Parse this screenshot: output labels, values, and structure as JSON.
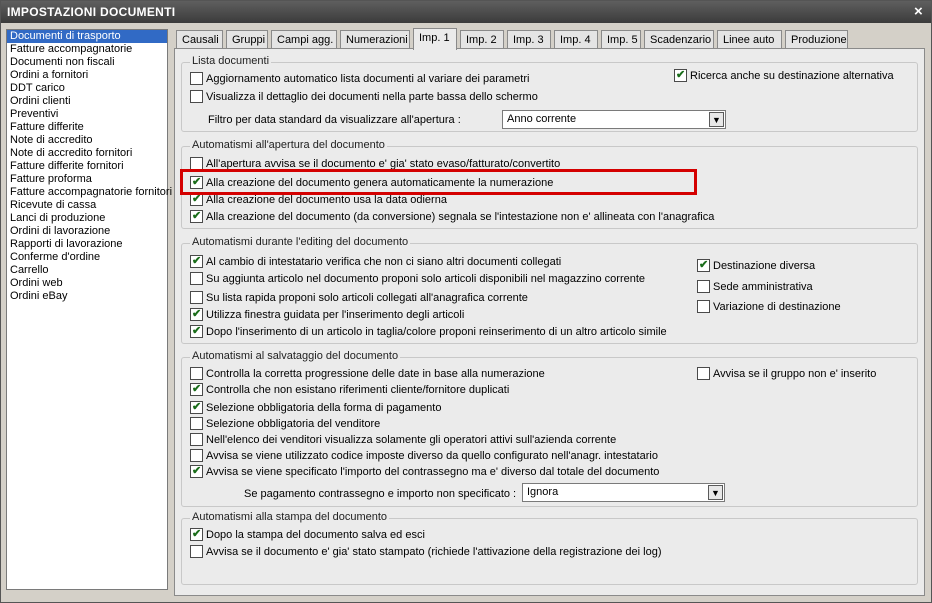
{
  "window": {
    "title": "IMPOSTAZIONI DOCUMENTI",
    "close_glyph": "×"
  },
  "sidebar": {
    "selected_index": 0,
    "items": [
      "Documenti di trasporto",
      "Fatture accompagnatorie",
      "Documenti non fiscali",
      "Ordini a fornitori",
      "DDT carico",
      "Ordini clienti",
      "Preventivi",
      "Fatture differite",
      "Note di accredito",
      "Note di accredito fornitori",
      "Fatture differite fornitori",
      "Fatture proforma",
      "Fatture accompagnatorie fornitori",
      "Ricevute di cassa",
      "Lanci di produzione",
      "Ordini di lavorazione",
      "Rapporti di lavorazione",
      "Conferme d'ordine",
      "Carrello",
      "Ordini web",
      "Ordini eBay"
    ]
  },
  "tabs": {
    "active_index": 4,
    "items": [
      "Causali",
      "Gruppi",
      "Campi agg.",
      "Numerazioni",
      "Imp. 1",
      "Imp. 2",
      "Imp. 3",
      "Imp. 4",
      "Imp. 5",
      "Scadenzario",
      "Linee auto",
      "Produzione"
    ]
  },
  "groups": {
    "lista": {
      "title": "Lista documenti",
      "options": [
        {
          "label": "Aggiornamento automatico lista documenti al variare dei parametri",
          "checked": false
        },
        {
          "label": "Visualizza il dettaglio dei documenti nella parte bassa dello schermo",
          "checked": false
        },
        {
          "label": "Ricerca anche su destinazione alternativa",
          "checked": true
        }
      ],
      "filter_label": "Filtro per data standard da visualizzare all'apertura :",
      "filter_value": "Anno corrente"
    },
    "apertura": {
      "title": "Automatismi all'apertura del documento",
      "options": [
        {
          "label": "All'apertura avvisa se il documento e' gia' stato evaso/fatturato/convertito",
          "checked": false
        },
        {
          "label": "Alla creazione del documento genera automaticamente la numerazione",
          "checked": true
        },
        {
          "label": "Alla creazione del documento usa la data odierna",
          "checked": true
        },
        {
          "label": "Alla creazione del documento (da conversione) segnala se l'intestazione non e' allineata con l'anagrafica",
          "checked": true
        }
      ]
    },
    "editing": {
      "title": "Automatismi durante l'editing del documento",
      "options": [
        {
          "label": "Al cambio di intestatario verifica che non ci siano altri documenti collegati",
          "checked": true
        },
        {
          "label": "Su aggiunta articolo nel documento proponi solo articoli disponibili nel magazzino corrente",
          "checked": false
        },
        {
          "label": "Su lista rapida proponi solo articoli collegati all'anagrafica corrente",
          "checked": false
        },
        {
          "label": "Utilizza finestra guidata per l'inserimento degli articoli",
          "checked": true
        },
        {
          "label": "Dopo l'inserimento di un articolo in taglia/colore proponi reinserimento di un altro articolo simile",
          "checked": true
        },
        {
          "label": "Destinazione diversa",
          "checked": true
        },
        {
          "label": "Sede amministrativa",
          "checked": false
        },
        {
          "label": "Variazione di destinazione",
          "checked": false
        }
      ]
    },
    "salvataggio": {
      "title": "Automatismi al salvataggio del documento",
      "options": [
        {
          "label": "Controlla la corretta progressione delle date in base alla numerazione",
          "checked": false
        },
        {
          "label": "Controlla che non esistano riferimenti cliente/fornitore duplicati",
          "checked": true
        },
        {
          "label": "Selezione obbligatoria della forma di pagamento",
          "checked": true
        },
        {
          "label": "Selezione obbligatoria del venditore",
          "checked": false
        },
        {
          "label": "Nell'elenco dei venditori visualizza solamente gli operatori attivi sull'azienda corrente",
          "checked": false
        },
        {
          "label": "Avvisa se viene utilizzato codice imposte diverso da quello configurato nell'anagr. intestatario",
          "checked": false
        },
        {
          "label": "Avvisa se viene specificato l'importo del contrassegno ma e' diverso dal totale del documento",
          "checked": true
        },
        {
          "label": "Avvisa se il gruppo non e' inserito",
          "checked": false
        }
      ],
      "contrassegno_label": "Se pagamento contrassegno e importo non specificato :",
      "contrassegno_value": "Ignora"
    },
    "stampa": {
      "title": "Automatismi alla stampa del documento",
      "options": [
        {
          "label": "Dopo la stampa del documento salva ed esci",
          "checked": true
        },
        {
          "label": "Avvisa se il documento e' gia' stato stampato (richiede l'attivazione della registrazione dei log)",
          "checked": false
        }
      ]
    }
  },
  "colors": {
    "selection": "#316ac5",
    "highlight_border": "#d40000",
    "check": "#1a6d1a"
  }
}
